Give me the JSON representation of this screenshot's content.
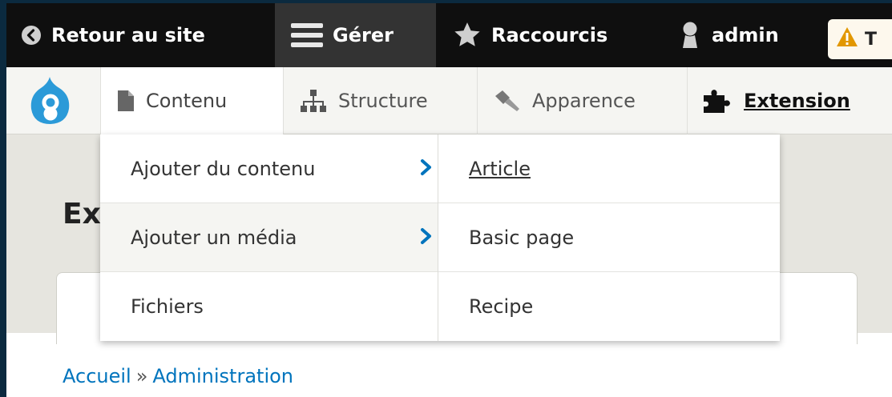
{
  "toolbar": {
    "back_label": "Retour au site",
    "manage_label": "Gérer",
    "shortcuts_label": "Raccourcis",
    "user_label": "admin",
    "warning_label": "T"
  },
  "tray": {
    "items": [
      {
        "label": "Contenu",
        "icon": "file-icon"
      },
      {
        "label": "Structure",
        "icon": "sitemap-icon"
      },
      {
        "label": "Apparence",
        "icon": "paintbrush-icon"
      },
      {
        "label": "Extension",
        "icon": "puzzle-icon"
      }
    ]
  },
  "dropdown": {
    "left_items": [
      {
        "label": "Ajouter du contenu",
        "has_submenu": true
      },
      {
        "label": "Ajouter un média",
        "has_submenu": true
      },
      {
        "label": "Fichiers",
        "has_submenu": false
      }
    ],
    "right_items": [
      {
        "label": "Article"
      },
      {
        "label": "Basic page"
      },
      {
        "label": "Recipe"
      }
    ]
  },
  "page": {
    "title_fragment": "Ex",
    "breadcrumb": [
      {
        "label": "Accueil"
      },
      {
        "label": "Administration"
      }
    ],
    "breadcrumb_separator": "»"
  },
  "colors": {
    "toolbar_bg": "#0f0f0f",
    "manage_active_bg": "#333333",
    "tray_bg": "#f5f5f2",
    "link_blue": "#0074bd",
    "drupal_blue": "#2b9ad8",
    "warning_orange": "#e29700"
  }
}
